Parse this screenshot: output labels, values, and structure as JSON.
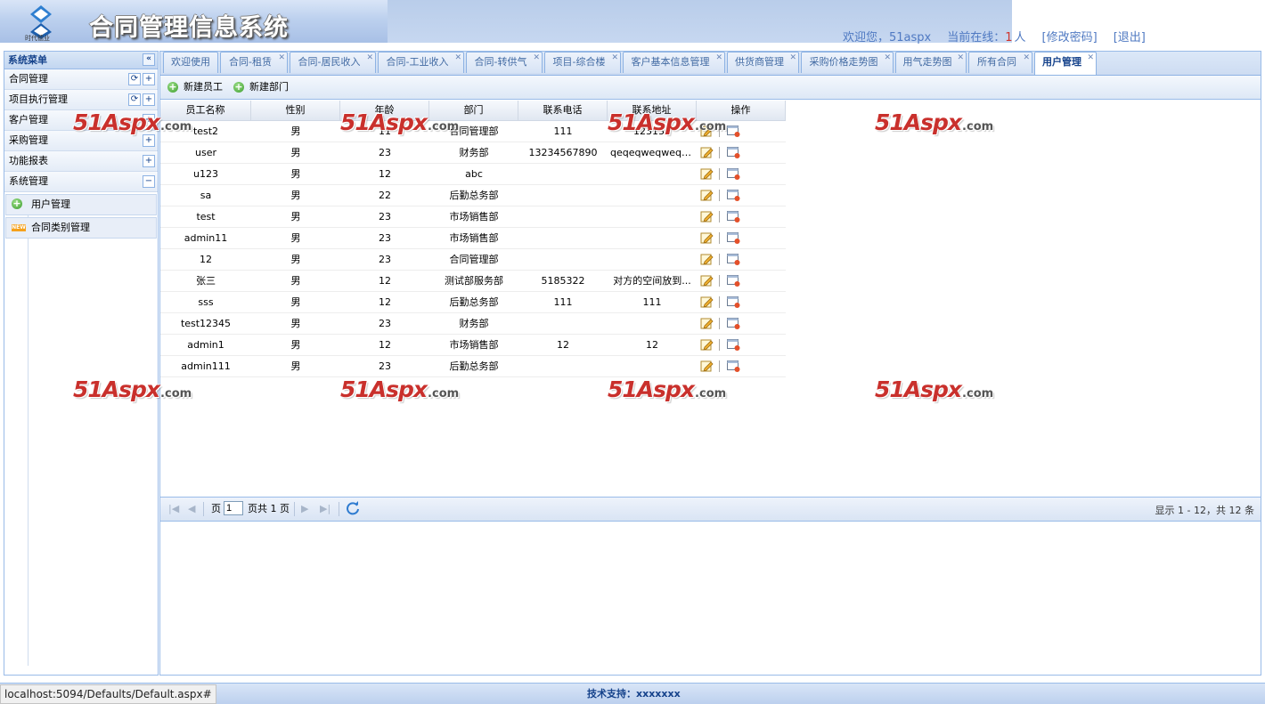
{
  "header": {
    "logo_sub": "时代德业",
    "title": "合同管理信息系统",
    "welcome": "欢迎您，51aspx",
    "online_label": "当前在线：",
    "online_count": "1",
    "online_unit": "人",
    "change_password": "[修改密码]",
    "logout": "[退出]"
  },
  "sidebar": {
    "title": "系统菜单",
    "items": [
      {
        "label": "合同管理",
        "buttons": [
          "refresh",
          "plus"
        ]
      },
      {
        "label": "项目执行管理",
        "buttons": [
          "refresh",
          "plus"
        ]
      },
      {
        "label": "客户管理",
        "buttons": [
          "plus"
        ]
      },
      {
        "label": "采购管理",
        "buttons": [
          "plus"
        ]
      },
      {
        "label": "功能报表",
        "buttons": [
          "plus"
        ]
      },
      {
        "label": "系统管理",
        "buttons": [
          "minus"
        ]
      }
    ],
    "sub_items": [
      {
        "label": "用户管理",
        "icon": "add-circle-icon"
      },
      {
        "label": "合同类别管理",
        "icon": "new-badge-icon",
        "badge": "NEW"
      }
    ]
  },
  "tabs": [
    {
      "label": "欢迎使用",
      "closable": false,
      "active": false
    },
    {
      "label": "合同-租赁",
      "closable": true,
      "active": false
    },
    {
      "label": "合同-居民收入",
      "closable": true,
      "active": false
    },
    {
      "label": "合同-工业收入",
      "closable": true,
      "active": false
    },
    {
      "label": "合同-转供气",
      "closable": true,
      "active": false
    },
    {
      "label": "项目-综合楼",
      "closable": true,
      "active": false
    },
    {
      "label": "客户基本信息管理",
      "closable": true,
      "active": false
    },
    {
      "label": "供货商管理",
      "closable": true,
      "active": false
    },
    {
      "label": "采购价格走势图",
      "closable": true,
      "active": false
    },
    {
      "label": "用气走势图",
      "closable": true,
      "active": false
    },
    {
      "label": "所有合同",
      "closable": true,
      "active": false
    },
    {
      "label": "用户管理",
      "closable": true,
      "active": true
    }
  ],
  "toolbar": {
    "new_employee": "新建员工",
    "new_department": "新建部门"
  },
  "grid": {
    "columns": [
      "员工名称",
      "性别",
      "年龄",
      "部门",
      "联系电话",
      "联系地址",
      "操作"
    ],
    "rows": [
      [
        "test2",
        "男",
        "11",
        "合同管理部",
        "111",
        "123132"
      ],
      [
        "user",
        "男",
        "23",
        "财务部",
        "13234567890",
        "qeqeqweqweqwe"
      ],
      [
        "u123",
        "男",
        "12",
        "abc",
        "",
        ""
      ],
      [
        "sa",
        "男",
        "22",
        "后勤总务部",
        "",
        ""
      ],
      [
        "test",
        "男",
        "23",
        "市场销售部",
        "",
        ""
      ],
      [
        "admin11",
        "男",
        "23",
        "市场销售部",
        "",
        ""
      ],
      [
        "12",
        "男",
        "23",
        "合同管理部",
        "",
        ""
      ],
      [
        "张三",
        "男",
        "12",
        "测试部服务部",
        "5185322",
        "对方的空间放到..."
      ],
      [
        "sss",
        "男",
        "12",
        "后勤总务部",
        "111",
        "111"
      ],
      [
        "test12345",
        "男",
        "23",
        "财务部",
        "",
        ""
      ],
      [
        "admin1",
        "男",
        "12",
        "市场销售部",
        "12",
        "12"
      ],
      [
        "admin111",
        "男",
        "23",
        "后勤总务部",
        "",
        ""
      ]
    ]
  },
  "pager": {
    "page_label": "页",
    "page_value": "1",
    "total_label": "页共 1 页",
    "info": "显示 1 - 12，共 12 条"
  },
  "watermark": {
    "main": "51Aspx",
    "sub": ".com"
  },
  "footer": {
    "support": "技术支持：xxxxxxx"
  },
  "statusbar": {
    "url": "localhost:5094/Defaults/Default.aspx#"
  },
  "colors": {
    "accent": "#15428b",
    "border": "#99bbe8",
    "link": "#4f79c2",
    "watermark": "#c9302c"
  }
}
